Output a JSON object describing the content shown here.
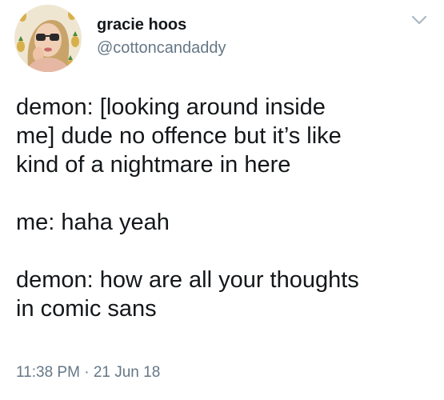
{
  "user": {
    "display_name": "gracie hoos",
    "handle": "@cottoncandaddy"
  },
  "tweet": {
    "paragraphs": [
      "demon: [looking around inside\nme] dude no offence but it’s like\nkind of a nightmare in here",
      "me: haha yeah",
      "demon: how are all your thoughts\nin comic sans"
    ],
    "time": "11:38 PM",
    "separator": "·",
    "date": "21 Jun 18"
  },
  "icons": {
    "menu": "chevron-down-icon",
    "avatar": "profile-photo"
  },
  "colors": {
    "text": "#14171a",
    "secondary": "#657786",
    "chevron": "#aab8c2"
  }
}
